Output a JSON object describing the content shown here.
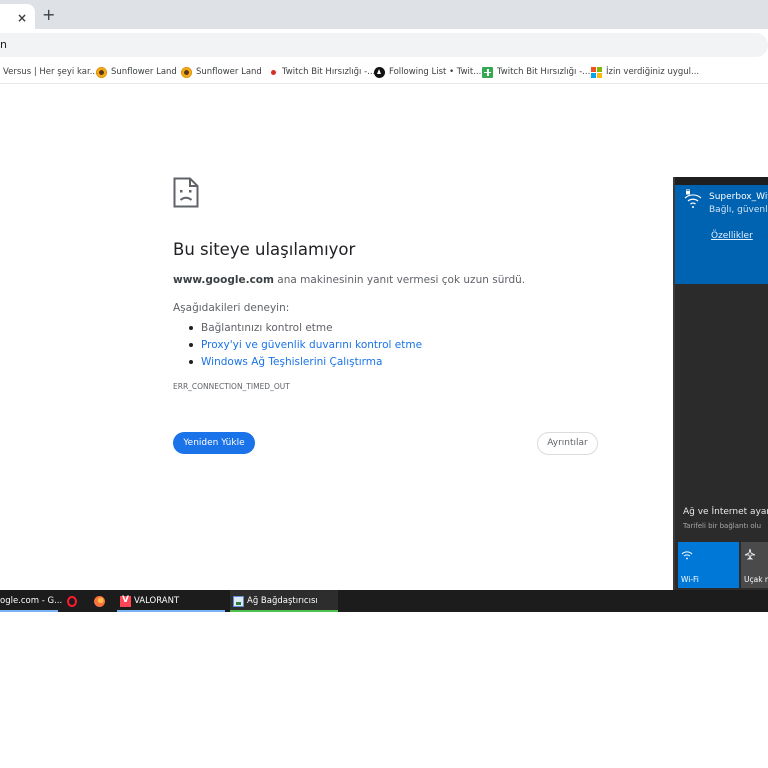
{
  "browser": {
    "tab_close_glyph": "×",
    "new_tab_glyph": "+",
    "address": "n",
    "bookmarks": [
      {
        "label": "Versus | Her şeyi kar...",
        "icon": "none"
      },
      {
        "label": "Sunflower Land",
        "icon": "sunflower-icon"
      },
      {
        "label": "Sunflower Land",
        "icon": "sunflower-icon"
      },
      {
        "label": "Twitch Bit Hırsızlığı -...",
        "icon": "red-dot-icon"
      },
      {
        "label": "Following List • Twit...",
        "icon": "following-icon"
      },
      {
        "label": "Twitch Bit Hırsızlığı -...",
        "icon": "google-sheets-icon"
      },
      {
        "label": "İzin verdiğiniz uygul...",
        "icon": "microsoft-icon"
      }
    ]
  },
  "error_page": {
    "title": "Bu siteye ulaşılamıyor",
    "host": "www.google.com",
    "summary_rest": " ana makinesinin yanıt vermesi çok uzun sürdü.",
    "try_heading": "Aşağıdakileri deneyin:",
    "suggestions": [
      {
        "text": "Bağlantınızı kontrol etme",
        "link": false
      },
      {
        "text": "Proxy'yi ve güvenlik duvarını kontrol etme",
        "link": true
      },
      {
        "text": "Windows Ağ Teşhislerini Çalıştırma",
        "link": true
      }
    ],
    "error_code": "ERR_CONNECTION_TIMED_OUT",
    "reload_label": "Yeniden Yükle",
    "details_label": "Ayrıntılar"
  },
  "network_flyout": {
    "ssid": "Superbox_Wifi",
    "status": "Bağlı, güvenli",
    "properties_link": "Özellikler",
    "settings_heading": "Ağ ve İnternet ayarları",
    "settings_sub": "Tarifeli bir bağlantı olu",
    "quick_actions": [
      {
        "label": "Wi-Fi",
        "active": true
      },
      {
        "label": "Uçak modu",
        "active": false
      }
    ]
  },
  "taskbar": {
    "items": [
      {
        "label": "ogle.com - G...",
        "icon": "chrome-icon"
      },
      {
        "label": "",
        "icon": "opera-icon"
      },
      {
        "label": "",
        "icon": "firefox-icon"
      },
      {
        "label": "VALORANT",
        "icon": "valorant-icon"
      },
      {
        "label": "Ağ Bağdaştırıcısı",
        "icon": "network-adapter-icon"
      }
    ]
  },
  "colors": {
    "link": "#1a73e8",
    "reload_button": "#1a73e8",
    "flyout_accent": "#0063b1",
    "wifi_tile_active": "#0078d7",
    "taskbar": "#1c1c1c"
  }
}
